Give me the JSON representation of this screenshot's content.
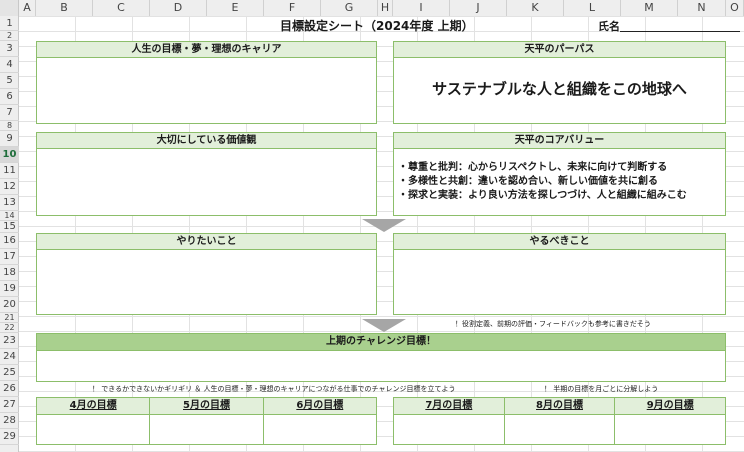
{
  "sheet": {
    "columns": [
      "A",
      "B",
      "C",
      "D",
      "E",
      "F",
      "G",
      "H",
      "I",
      "J",
      "K",
      "L",
      "M",
      "N",
      "O"
    ],
    "rows": [
      "1",
      "2",
      "3",
      "4",
      "5",
      "6",
      "7",
      "8",
      "9",
      "10",
      "11",
      "12",
      "13",
      "14",
      "15",
      "16",
      "17",
      "18",
      "19",
      "20",
      "21",
      "22",
      "23",
      "24",
      "25",
      "26",
      "27",
      "28",
      "29"
    ],
    "selected_row": "10"
  },
  "header": {
    "title": "目標設定シート（2024年度 上期）",
    "name_label": "氏名"
  },
  "sections": {
    "life_goals": "人生の目標・夢・理想のキャリア",
    "purpose_title": "天平のパーパス",
    "purpose_text": "サステナブルな人と組織をこの地球へ",
    "values_title": "大切にしている価値観",
    "core_values_title": "天平のコアバリュー",
    "core_values": [
      "・尊重と批判：心からリスペクトし、未来に向けて判断する",
      "・多様性と共創：違いを認め合い、新しい価値を共に創る",
      "・探求と実装：より良い方法を探しつづけ、人と組織に組みこむ"
    ],
    "want_to_do": "やりたいこと",
    "should_do": "やるべきこと"
  },
  "notes": {
    "role_note": "！役割定義、前期の評価・フィードバックも参考に書きだそう",
    "challenge_note": "！ できるかできないかギリギリ ＆ 人生の目標・夢・理想のキャリアにつながる仕事でのチャレンジ目標を立てよう",
    "split_note": "！ 半期の目標を月ごとに分解しよう"
  },
  "challenge": {
    "title": "上期のチャレンジ目標！"
  },
  "months": [
    "4月の目標",
    "5月の目標",
    "6月の目標",
    "7月の目標",
    "8月の目標",
    "9月の目標"
  ],
  "colors": {
    "border_green": "#8cbe6a",
    "header_green_light": "#e2efda",
    "header_green_dark": "#a9d08e",
    "arrow_gray": "#a6a6a6"
  }
}
